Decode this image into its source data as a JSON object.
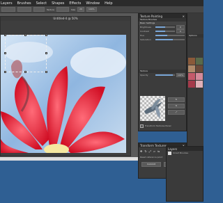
{
  "menu": [
    "Layers",
    "Brushes",
    "Select",
    "Shapes",
    "Effects",
    "Window",
    "Help"
  ],
  "toolbar": {
    "texture_label": "Texture",
    "size_label": "Size",
    "size_value": "26",
    "opacity_value": "100%"
  },
  "document": {
    "title": "Untitled-4 @ 50%"
  },
  "texture_painting": {
    "title": "Texture Painting",
    "tab": "Texture Brushes",
    "basic_settings": "Basic Settings",
    "brightness_label": "Brightness",
    "brightness_value": "0",
    "contrast_label": "Contrast",
    "contrast_value": "0",
    "texture_label": "Texture",
    "opacity_label": "Opacity",
    "opacity_value": "100%",
    "hue_label": "Hue",
    "saturation_label": "Saturation",
    "checkbox_label": "Transform Textures Panel",
    "paint_label": "Paint Texture"
  },
  "transform_textures": {
    "title": "Transform Textures",
    "reset_label": "Reset reference point",
    "cancel_label": "Cancel",
    "ok_label": "Commit"
  },
  "right_panel": {
    "section": "Options",
    "brush_label": "Brushes"
  },
  "layers_panel": {
    "title": "Layers",
    "item": "Smart Brushes"
  },
  "colors": {
    "accent": "#7aa7d8",
    "menubar": "#2b2b2b",
    "panel": "#3c3c3c",
    "desktop": "#2f5f93"
  }
}
